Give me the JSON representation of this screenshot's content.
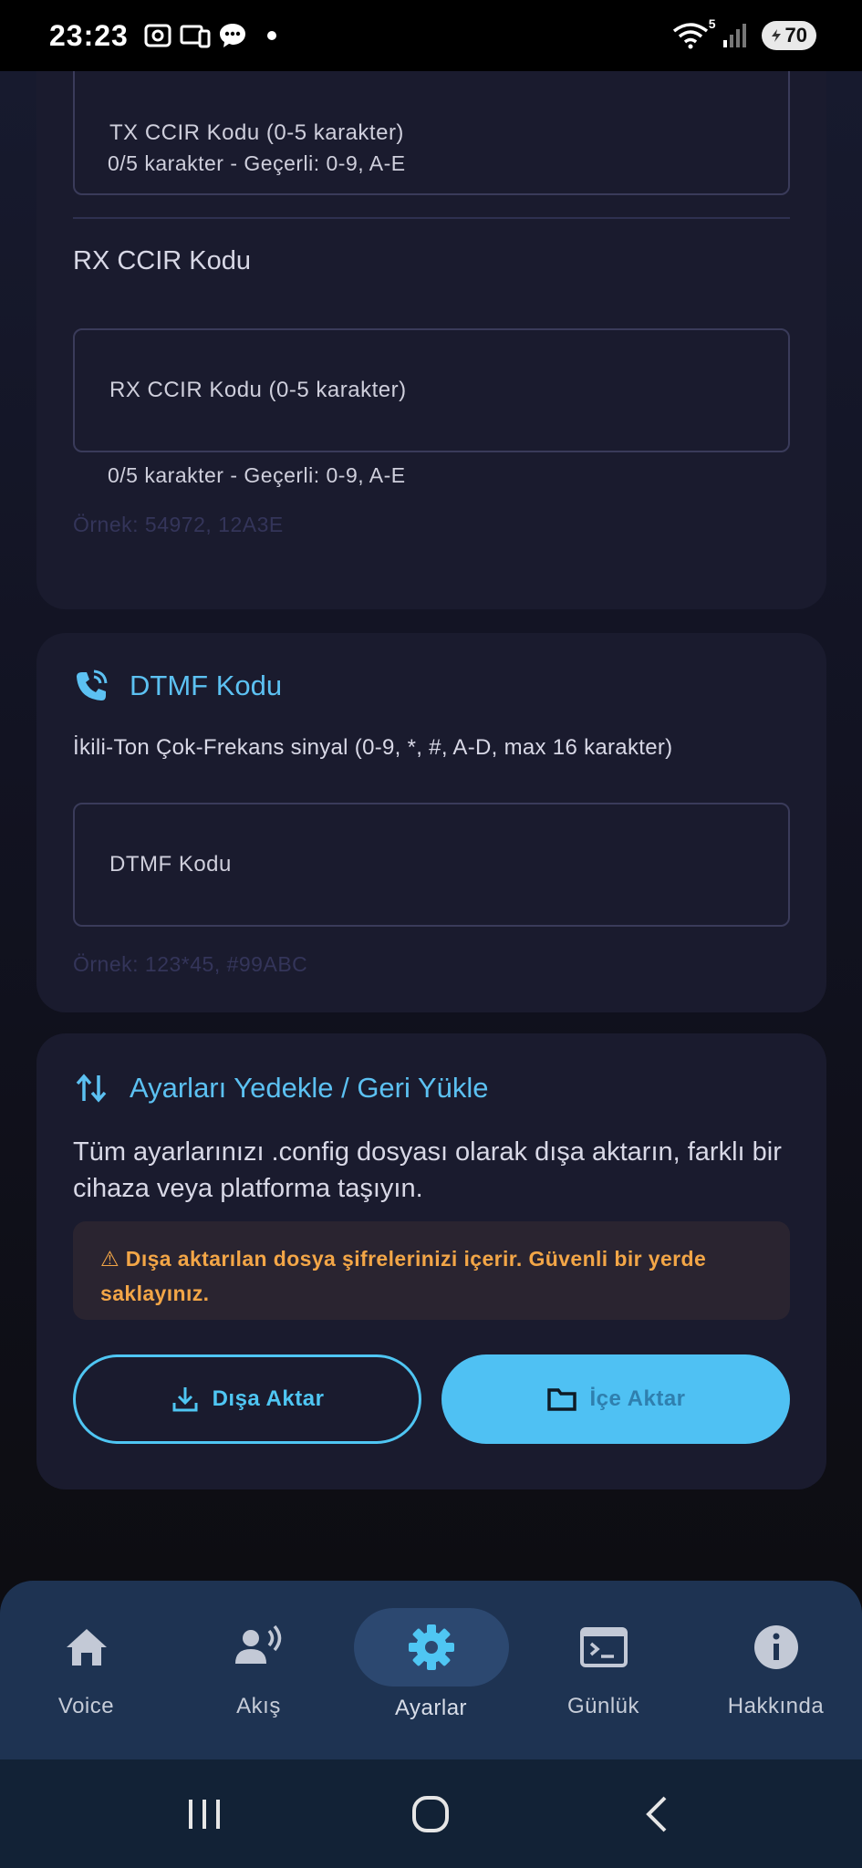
{
  "status_bar": {
    "time": "23:23",
    "battery": "70",
    "wifi_badge": "5"
  },
  "ccir": {
    "tx_placeholder": "TX CCIR Kodu (0-5 karakter)",
    "tx_helper": "0/5 karakter - Geçerli: 0-9, A-E",
    "rx_label": "RX CCIR Kodu",
    "rx_placeholder": "RX CCIR Kodu (0-5 karakter)",
    "rx_helper": "0/5 karakter - Geçerli: 0-9, A-E",
    "example": "Örnek: 54972, 12A3E"
  },
  "dtmf": {
    "title": "DTMF Kodu",
    "description": "İkili-Ton Çok-Frekans sinyal (0-9, *, #, A-D, max 16 karakter)",
    "placeholder": "DTMF Kodu",
    "example": "Örnek: 123*45, #99ABC"
  },
  "backup": {
    "title": "Ayarları Yedekle / Geri Yükle",
    "description": "Tüm ayarlarınızı .config dosyası olarak dışa aktarın, farklı bir cihaza veya platforma taşıyın.",
    "warning": "⚠ Dışa aktarılan dosya şifrelerinizi içerir. Güvenli bir yerde saklayınız.",
    "export_label": "Dışa Aktar",
    "import_label": "İçe Aktar"
  },
  "bottom_nav": {
    "items": [
      {
        "label": "Voice",
        "icon": "home-icon"
      },
      {
        "label": "Akış",
        "icon": "speaker-person-icon"
      },
      {
        "label": "Ayarlar",
        "icon": "gear-icon",
        "active": true
      },
      {
        "label": "Günlük",
        "icon": "terminal-icon"
      },
      {
        "label": "Hakkında",
        "icon": "info-icon"
      }
    ]
  },
  "colors": {
    "accent": "#5cc1f2",
    "warning": "#f3a647",
    "card": "#1a1b2e",
    "nav": "#1e3352"
  }
}
